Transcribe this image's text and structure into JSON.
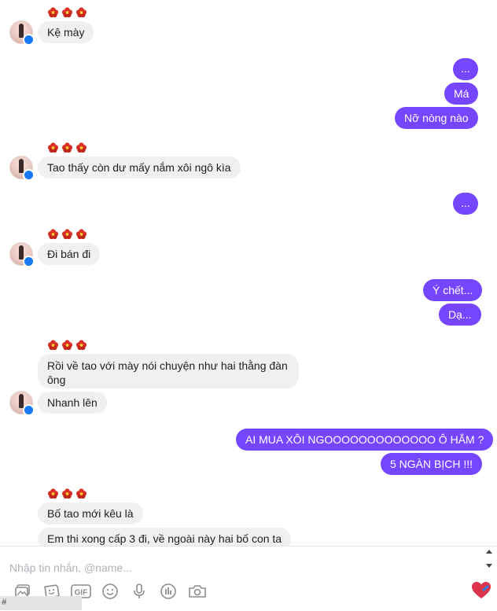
{
  "messages": [
    {
      "side": "in",
      "text": "Kệ mày"
    },
    {
      "side": "out",
      "text": "..."
    },
    {
      "side": "out",
      "text": "Má"
    },
    {
      "side": "out",
      "text": "Nỡ nòng nào"
    },
    {
      "side": "in",
      "text": "Tao thấy còn dư mấy nắm xôi ngô kìa"
    },
    {
      "side": "out",
      "text": "..."
    },
    {
      "side": "in",
      "text": "Đi bán đi"
    },
    {
      "side": "out",
      "text": "Ý chết..."
    },
    {
      "side": "out",
      "text": "Dạ..."
    },
    {
      "side": "in",
      "text": "Rồi về tao với mày nói chuyện như hai thằng đàn ông"
    },
    {
      "side": "in",
      "text": "Nhanh lên"
    },
    {
      "side": "out",
      "text": "AI MUA XÔI NGOOOOOOOOOOOOO Ô HẮM ?"
    },
    {
      "side": "out",
      "text": "5 NGÀN BỊCH !!!"
    },
    {
      "side": "in",
      "text": "Bố tao mới kêu là"
    },
    {
      "side": "in",
      "text": "Em thi xong cấp 3 đi, về ngoài này hai bố con ta"
    }
  ],
  "composer": {
    "placeholder": "Nhập tin nhắn, @name..."
  },
  "toolbar_icons": [
    "image-icon",
    "sticker-icon",
    "gif-icon",
    "emoji-icon",
    "microphone-icon",
    "poll-icon",
    "camera-icon"
  ],
  "toolbar": {
    "gif_label": "GIF"
  },
  "reaction_icon": "heart-icon",
  "status": {
    "text": "#"
  },
  "colors": {
    "outgoing": "#7646ff",
    "incoming": "#f1f0f0",
    "flower": "#d93025"
  }
}
